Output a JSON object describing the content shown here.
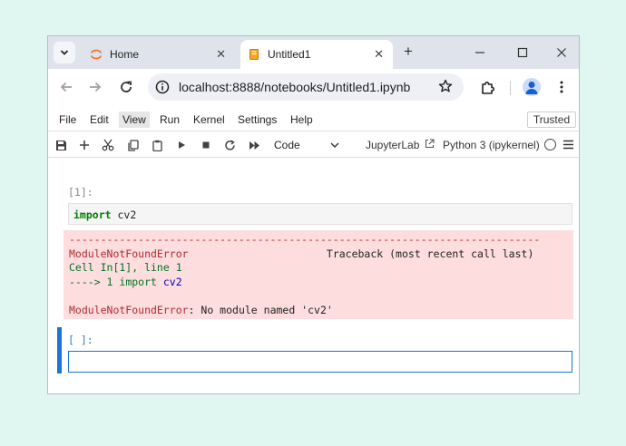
{
  "browser": {
    "tabs": [
      {
        "title": "Home",
        "active": false,
        "icon": "jupyter-logo-icon"
      },
      {
        "title": "Untitled1",
        "active": true,
        "icon": "notebook-icon"
      }
    ],
    "new_tab": "+",
    "close_glyph": "✕",
    "url": "localhost:8888/notebooks/Untitled1.ipynb"
  },
  "jupyter": {
    "menu": [
      "File",
      "Edit",
      "View",
      "Run",
      "Kernel",
      "Settings",
      "Help"
    ],
    "active_menu": "View",
    "trusted": "Trusted",
    "cell_type": "Code",
    "jupyterlab_link": "JupyterLab",
    "kernel": "Python 3 (ipykernel)"
  },
  "notebook": {
    "cell1_prompt": "[1]:",
    "cell1_code_kw": "import",
    "cell1_code_rest": " cv2",
    "error": {
      "dashes": "---------------------------------------------------------------------------",
      "name": "ModuleNotFoundError",
      "traceback_label": "Traceback (most recent call last)",
      "cell_ref": "Cell In[1], line 1",
      "arrow": "----> 1 ",
      "arrow_kw": "import",
      "arrow_mod": "cv2",
      "final_name": "ModuleNotFoundError",
      "final_msg": ": No module named 'cv2'"
    },
    "cell2_prompt": "[ ]:"
  },
  "colors": {
    "accent": "#1976d2",
    "error_bg": "#fddddd",
    "error_text": "#b22b31",
    "keyword": "#008000"
  }
}
